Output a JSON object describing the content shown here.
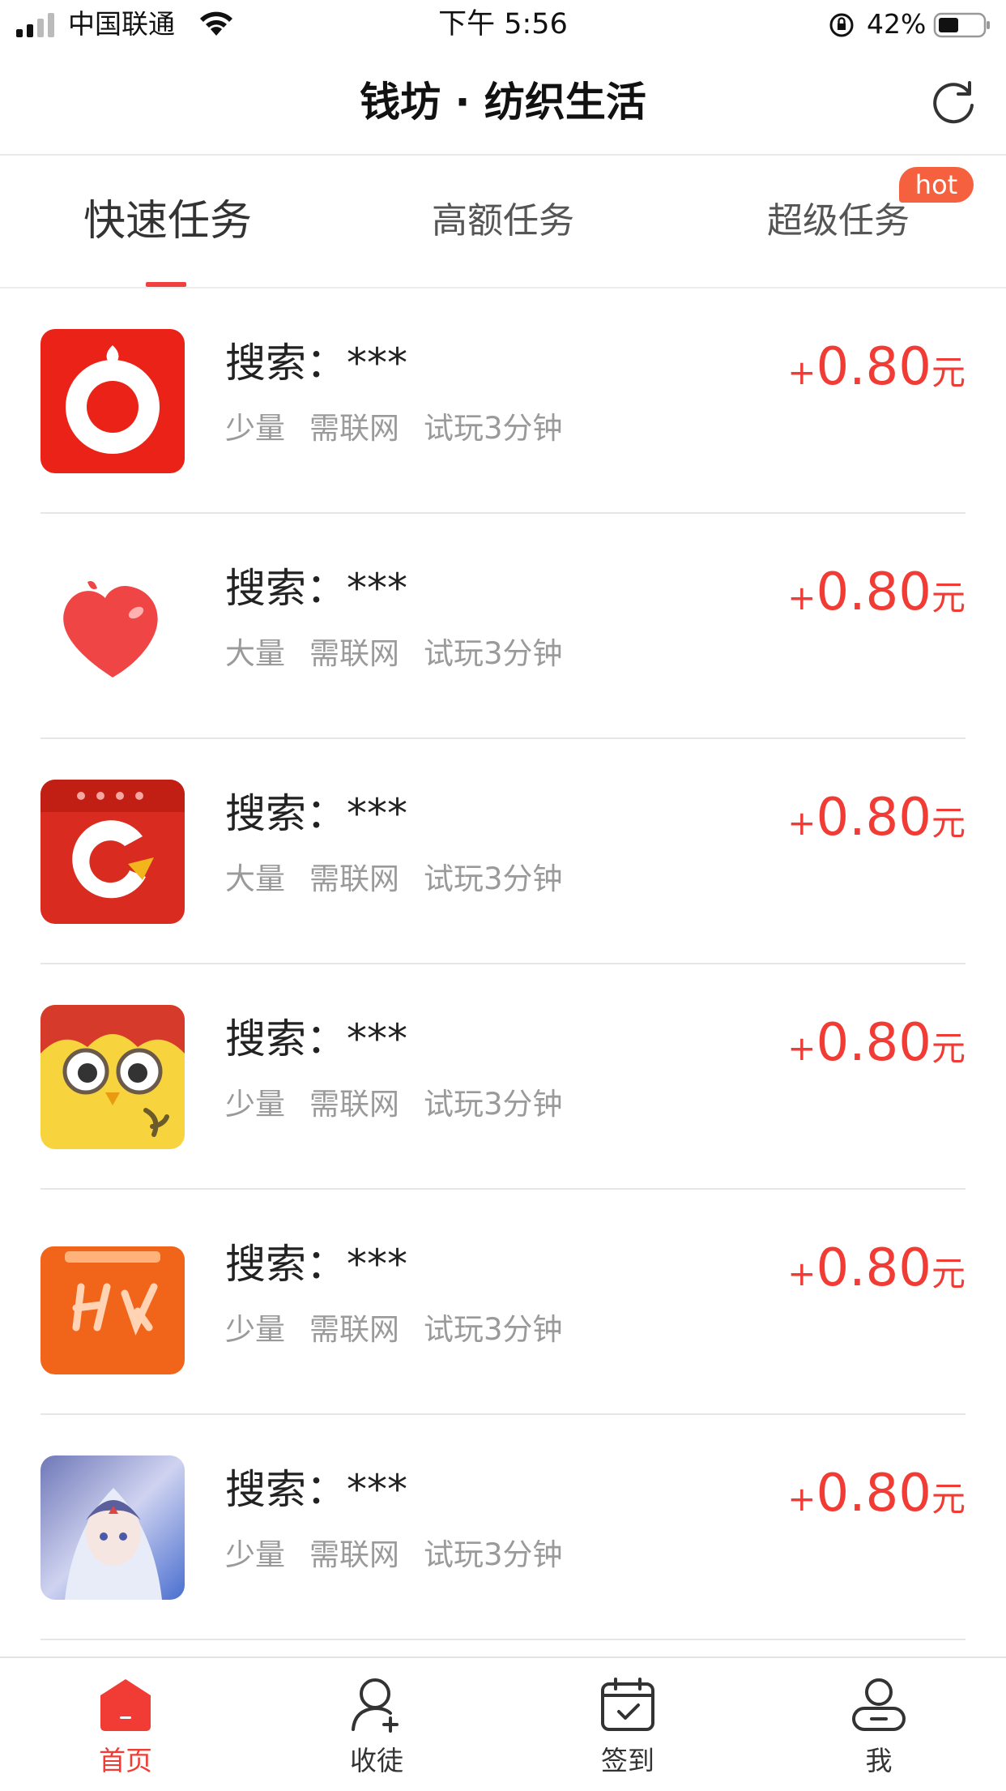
{
  "status_bar": {
    "carrier": "中国联通",
    "time": "下午 5:56",
    "battery": "42%"
  },
  "header": {
    "title": "钱坊 · 纺织生活",
    "refresh_icon": "refresh-icon"
  },
  "tabs": [
    {
      "label": "快速任务",
      "active": true
    },
    {
      "label": "高额任务",
      "active": false
    },
    {
      "label": "超级任务",
      "active": false,
      "badge": "hot"
    }
  ],
  "tasks": [
    {
      "title": "搜索：***",
      "quantity": "少量",
      "network": "需联网",
      "duration": "试玩3分钟",
      "plus": "+",
      "amount": "0.80",
      "unit": "元",
      "icon": "red-donut-app-icon"
    },
    {
      "title": "搜索：***",
      "quantity": "大量",
      "network": "需联网",
      "duration": "试玩3分钟",
      "plus": "+",
      "amount": "0.80",
      "unit": "元",
      "icon": "red-heart-app-icon"
    },
    {
      "title": "搜索：***",
      "quantity": "大量",
      "network": "需联网",
      "duration": "试玩3分钟",
      "plus": "+",
      "amount": "0.80",
      "unit": "元",
      "icon": "red-calendar-app-icon"
    },
    {
      "title": "搜索：***",
      "quantity": "少量",
      "network": "需联网",
      "duration": "试玩3分钟",
      "plus": "+",
      "amount": "0.80",
      "unit": "元",
      "icon": "yellow-owl-app-icon"
    },
    {
      "title": "搜索：***",
      "quantity": "少量",
      "network": "需联网",
      "duration": "试玩3分钟",
      "plus": "+",
      "amount": "0.80",
      "unit": "元",
      "icon": "orange-shop-app-icon"
    },
    {
      "title": "搜索：***",
      "quantity": "少量",
      "network": "需联网",
      "duration": "试玩3分钟",
      "plus": "+",
      "amount": "0.80",
      "unit": "元",
      "icon": "anime-girl-app-icon"
    }
  ],
  "tabbar": [
    {
      "label": "首页",
      "icon": "home-icon",
      "active": true
    },
    {
      "label": "收徒",
      "icon": "add-user-icon",
      "active": false
    },
    {
      "label": "签到",
      "icon": "calendar-check-icon",
      "active": false
    },
    {
      "label": "我",
      "icon": "profile-icon",
      "active": false
    }
  ],
  "colors": {
    "accent": "#f13c35",
    "hot_badge": "#f5613e",
    "tag_text": "#9a9a9a"
  }
}
